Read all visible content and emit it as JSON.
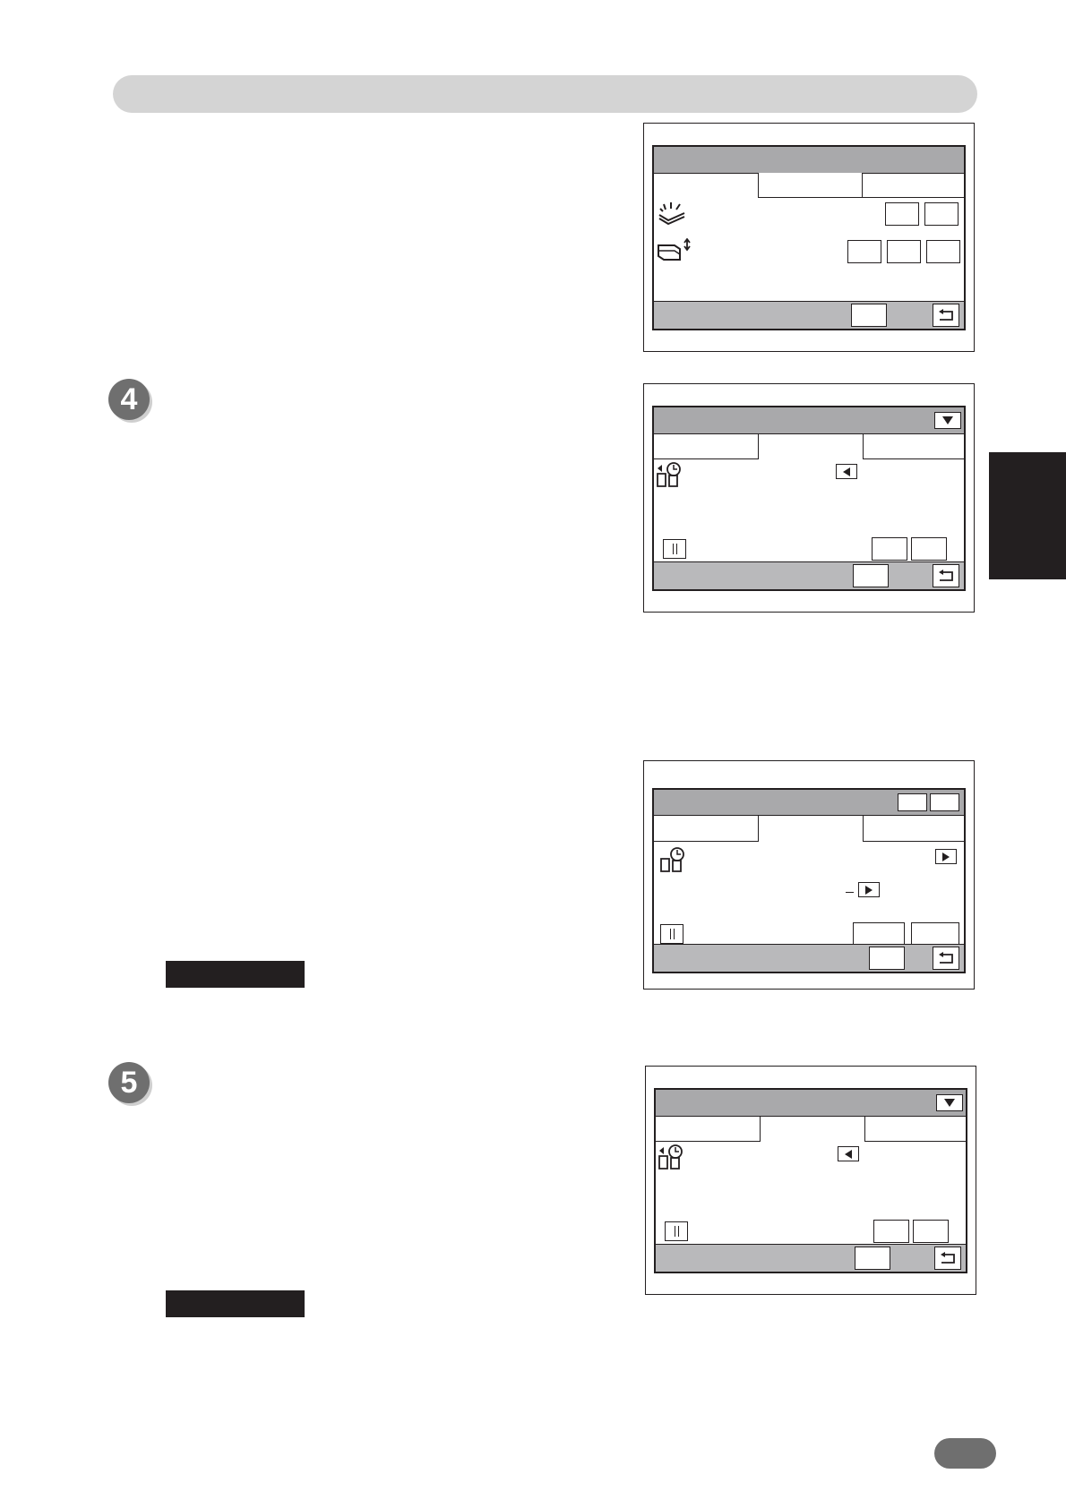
{
  "page": {
    "header_bar": "",
    "side_tab": "",
    "page_number": ""
  },
  "steps": [
    {
      "number": "4"
    },
    {
      "number": "5"
    }
  ],
  "notes": [
    {
      "label": ""
    },
    {
      "label": ""
    }
  ],
  "panels": {
    "panel_1": {
      "icons": [
        "feed-tray-icon",
        "paper-stack-adjust-icon"
      ],
      "return_icon": "return-icon"
    },
    "panel_2": {
      "icons": [
        "clock-document-icon",
        "left-arrow-icon",
        "pause-icon",
        "down-arrow-icon"
      ],
      "return_icon": "return-icon"
    },
    "panel_3": {
      "icons": [
        "clock-document-icon",
        "right-arrow-icon",
        "pause-icon"
      ],
      "return_icon": "return-icon"
    },
    "panel_4": {
      "icons": [
        "clock-document-icon",
        "left-arrow-icon",
        "pause-icon",
        "down-arrow-icon"
      ],
      "return_icon": "return-icon"
    }
  },
  "colors": {
    "ink": "#231f20",
    "header_gray": "#d4d4d4",
    "badge_gray": "#6f6f6f",
    "screen_title_gray": "#a9a9ab",
    "screen_bottom_gray": "#b9b9bb"
  }
}
